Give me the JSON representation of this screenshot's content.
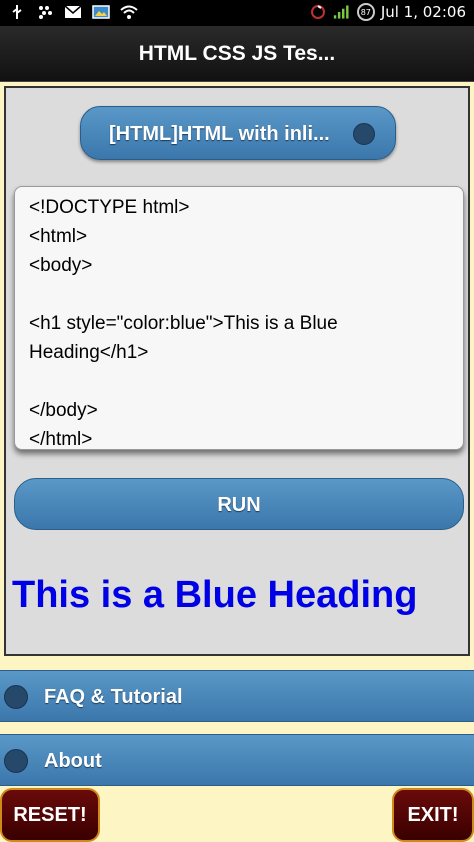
{
  "status_bar": {
    "time": "Jul 1, 02:06",
    "battery_level": "87",
    "left_icons": [
      "usb-icon",
      "blackberry-icon",
      "mail-icon",
      "image-icon",
      "wifi-icon"
    ],
    "right_icons": [
      "signal-strength-icon",
      "battery-icon"
    ]
  },
  "app": {
    "title": "HTML CSS JS Tes..."
  },
  "selector": {
    "label": "[HTML]HTML with inli..."
  },
  "editor": {
    "code": "<!DOCTYPE html>\n<html>\n<body>\n\n<h1 style=\"color:blue\">This is a Blue Heading</h1>\n\n</body>\n</html>"
  },
  "run_button": {
    "label": "RUN"
  },
  "output": {
    "heading": "This is a Blue Heading"
  },
  "menu": {
    "items": [
      {
        "label": "FAQ & Tutorial"
      },
      {
        "label": "About"
      }
    ]
  },
  "footer": {
    "reset_label": "RESET!",
    "exit_label": "EXIT!"
  },
  "colors": {
    "button_blue": "#4a88bc",
    "output_blue": "#0000e6",
    "page_background": "#fdf6c4",
    "footer_button": "#5a0505",
    "footer_border": "#d08a1a"
  }
}
